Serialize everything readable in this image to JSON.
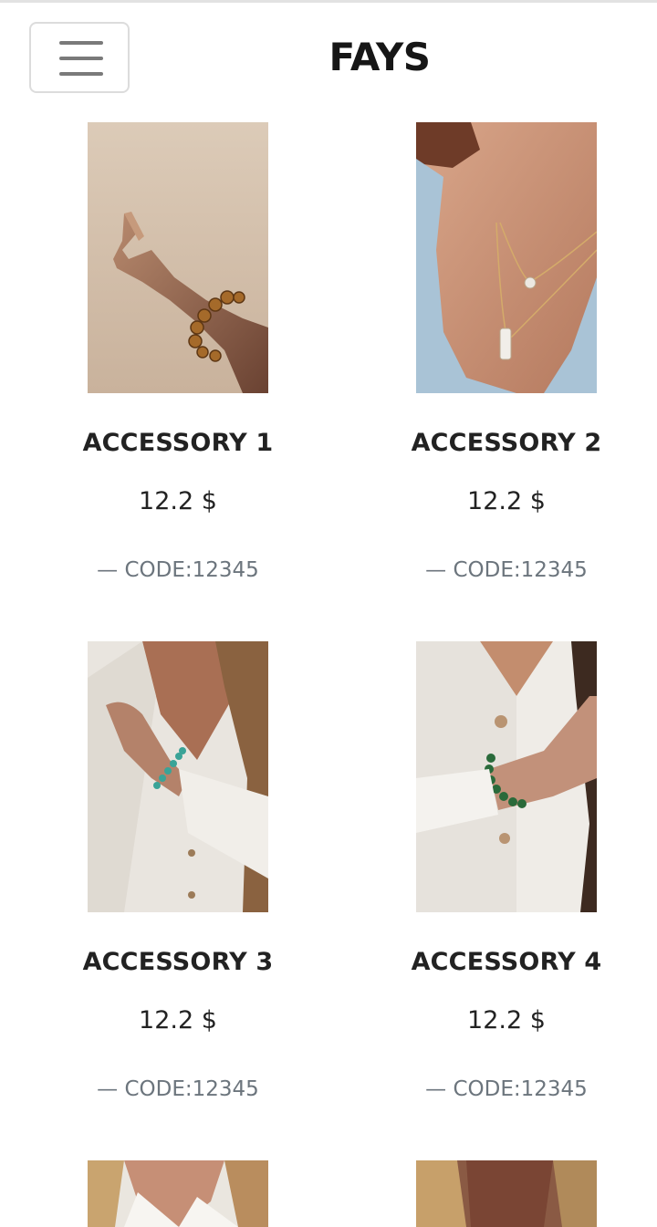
{
  "header": {
    "brand": "FAYS",
    "menu_icon": "hamburger-menu-icon"
  },
  "products": [
    {
      "name": "ACCESSORY 1",
      "price": "12.2 $",
      "code_dash": "—",
      "code": "CODE:12345",
      "image": "hand-gold-chain-bracelet-photo"
    },
    {
      "name": "ACCESSORY 2",
      "price": "12.2 $",
      "code_dash": "—",
      "code": "CODE:12345",
      "image": "layered-pendant-necklace-photo"
    },
    {
      "name": "ACCESSORY 3",
      "price": "12.2 $",
      "code_dash": "—",
      "code": "CODE:12345",
      "image": "turquoise-bead-bracelet-photo"
    },
    {
      "name": "ACCESSORY 4",
      "price": "12.2 $",
      "code_dash": "—",
      "code": "CODE:12345",
      "image": "green-bead-bracelet-photo"
    },
    {
      "name": "",
      "price": "",
      "code_dash": "",
      "code": "",
      "image": "model-white-shirt-photo"
    },
    {
      "name": "",
      "price": "",
      "code_dash": "",
      "code": "",
      "image": "model-long-hair-photo"
    }
  ],
  "colors": {
    "text": "#222222",
    "muted": "#6c757d",
    "border": "#dcdcdc"
  }
}
